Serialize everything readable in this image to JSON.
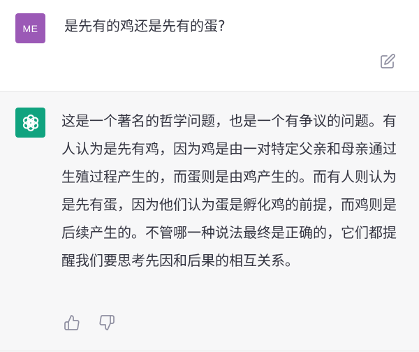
{
  "user": {
    "avatar_label": "ME",
    "avatar_color": "#9b59b6",
    "question": "是先有的鸡还是先有的蛋?"
  },
  "assistant": {
    "avatar_color": "#10a37f",
    "logo_icon": "openai-logo-icon",
    "answer": "这是一个著名的哲学问题，也是一个有争议的问题。有人认为是先有鸡，因为鸡是由一对特定父亲和母亲通过生殖过程产生的，而蛋则是由鸡产生的。而有人则认为是先有蛋，因为他们认为蛋是孵化鸡的前提，而鸡则是后续产生的。不管哪一种说法最终是正确的，它们都提醒我们要思考先因和后果的相互关系。"
  },
  "icons": {
    "edit": "edit-icon",
    "thumbs_up": "thumbs-up-icon",
    "thumbs_down": "thumbs-down-icon"
  },
  "colors": {
    "assistant_bg": "#f7f7f8",
    "text": "#343541",
    "icon": "#8e8ea0"
  }
}
